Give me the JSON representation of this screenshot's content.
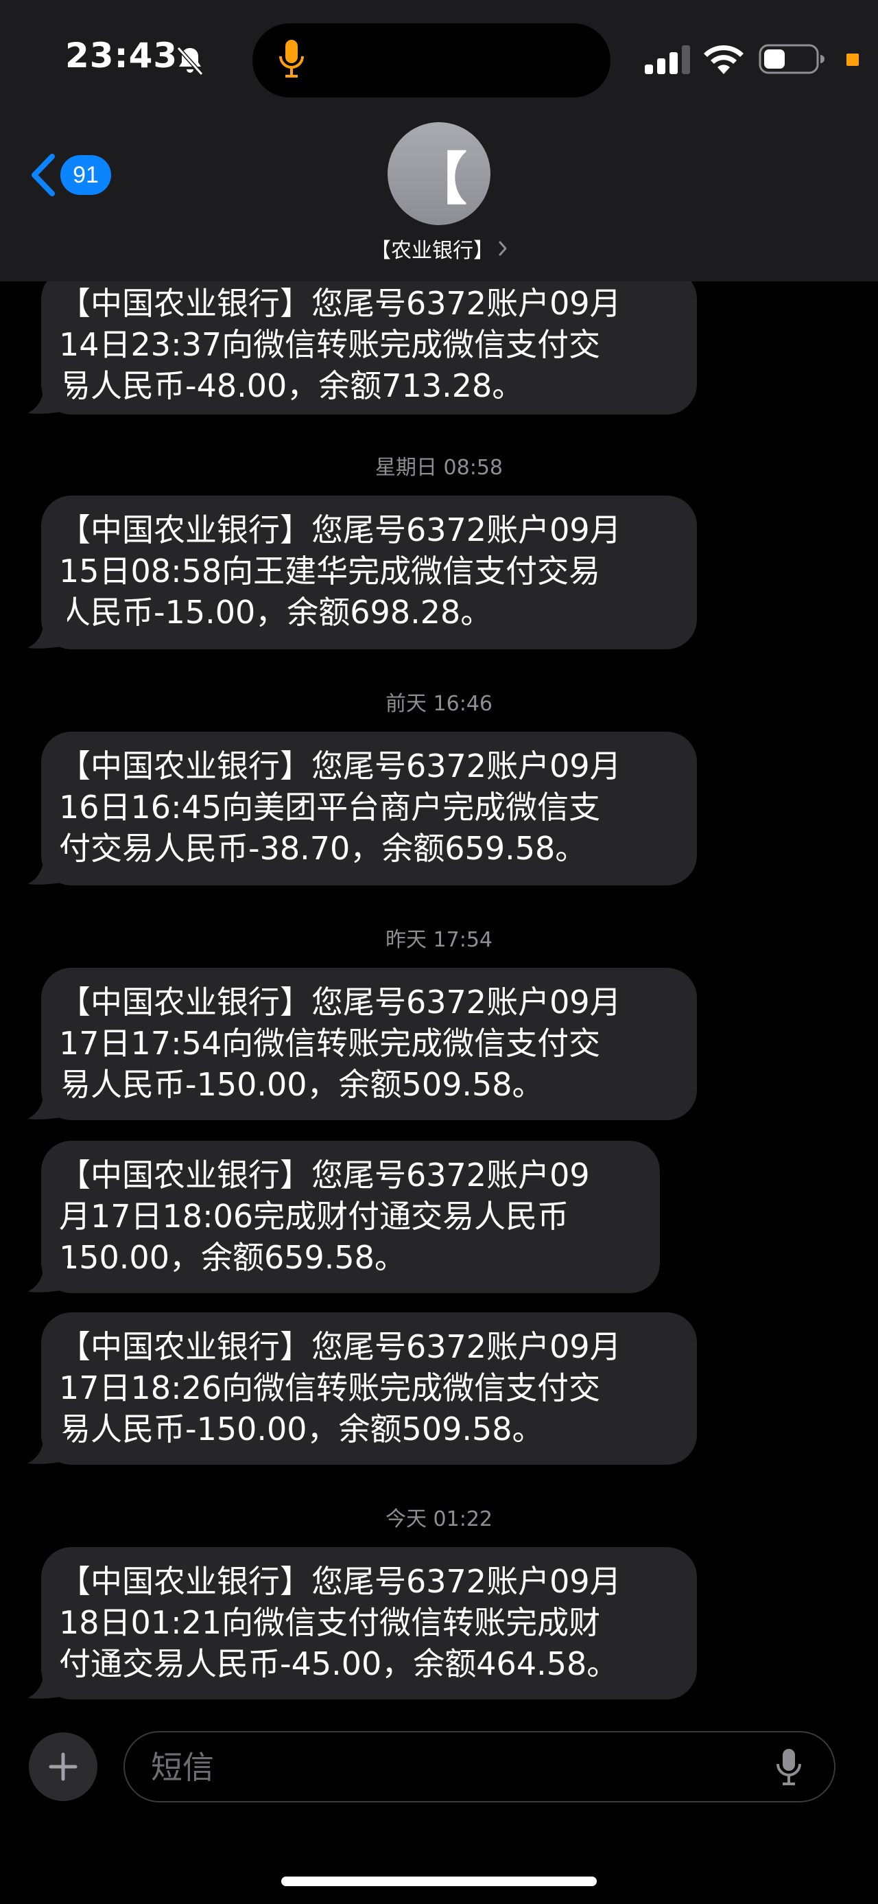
{
  "status_bar": {
    "time": "23:43"
  },
  "header": {
    "back_badge_count": "91",
    "avatar_glyph": "【",
    "contact_name": "【农业银行】"
  },
  "messages": [
    {
      "timestamp": "",
      "lines": [
        "【中国农业银行】您尾号6372账户09月",
        "14日23:37向微信转账完成微信支付交",
        "易人民币-48.00，余额713.28。"
      ]
    },
    {
      "timestamp": "星期日 08:58",
      "lines": [
        "【中国农业银行】您尾号6372账户09月",
        "15日08:58向王建华完成微信支付交易",
        "人民币-15.00，余额698.28。"
      ]
    },
    {
      "timestamp": "前天 16:46",
      "lines": [
        "【中国农业银行】您尾号6372账户09月",
        "16日16:45向美团平台商户完成微信支",
        "付交易人民币-38.70，余额659.58。"
      ]
    },
    {
      "timestamp": "昨天 17:54",
      "lines": [
        "【中国农业银行】您尾号6372账户09月",
        "17日17:54向微信转账完成微信支付交",
        "易人民币-150.00，余额509.58。"
      ]
    },
    {
      "timestamp": "",
      "lines": [
        "【中国农业银行】您尾号6372账户09",
        "月17日18:06完成财付通交易人民币",
        "150.00，余额659.58。"
      ]
    },
    {
      "timestamp": "",
      "lines": [
        "【中国农业银行】您尾号6372账户09月",
        "17日18:26向微信转账完成微信支付交",
        "易人民币-150.00，余额509.58。"
      ]
    },
    {
      "timestamp": "今天 01:22",
      "lines": [
        "【中国农业银行】您尾号6372账户09月",
        "18日01:21向微信支付微信转账完成财",
        "付通交易人民币-45.00，余额464.58。"
      ]
    }
  ],
  "input_bar": {
    "placeholder": "短信"
  },
  "colors": {
    "background": "#000000",
    "header": "#1c1c1e",
    "bubble": "#262628",
    "accent_blue": "#0a84ff",
    "timestamp_gray": "#8e8e93",
    "recording_orange": "#ff9f0a"
  },
  "icons": [
    "bell-slash-icon",
    "microphone-icon",
    "signal-icon",
    "wifi-icon",
    "battery-icon",
    "chevron-left-icon",
    "chevron-right-icon",
    "plus-icon",
    "dictation-mic-icon"
  ]
}
